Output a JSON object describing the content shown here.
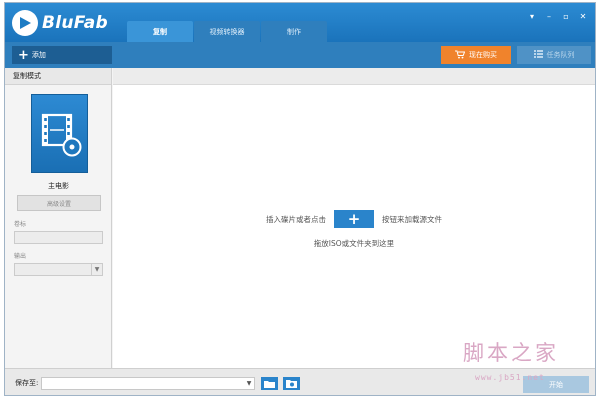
{
  "app": {
    "name": "BluFab"
  },
  "tabs": [
    {
      "label": "复制",
      "active": true
    },
    {
      "label": "视频转换器",
      "active": false
    },
    {
      "label": "制作",
      "active": false
    }
  ],
  "window_controls": {
    "menu": "▾",
    "minimize": "–",
    "maximize": "▫",
    "close": "✕"
  },
  "toolbar": {
    "add_label": "添加",
    "add_icon": "+",
    "buy_label": "现在购买",
    "queue_label": "任务队列"
  },
  "sidebar": {
    "header": "复制模式",
    "mode_label": "主电影",
    "advanced_button": "高级设置",
    "target_label": "卷标",
    "target_value": "",
    "output_label": "输出",
    "output_value": ""
  },
  "main": {
    "hint_before": "插入碟片或者点击",
    "hint_after": "按钮来加载源文件",
    "plus_label": "+",
    "hint_drag": "拖放ISO或文件夹到这里"
  },
  "bottom": {
    "save_label": "保存至:",
    "save_value": "",
    "start_button": "开始"
  },
  "watermark": {
    "main": "脚本之家",
    "sub": "www.jb51.net"
  },
  "colors": {
    "title_bar": "#1d7cc4",
    "accent": "#2a84cb",
    "buy_orange": "#f0832c"
  }
}
